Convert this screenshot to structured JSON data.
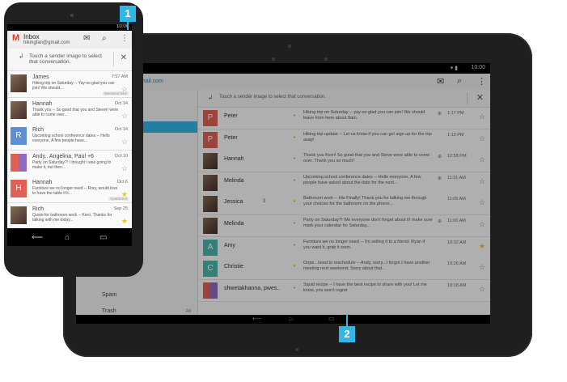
{
  "callouts": {
    "one": "1",
    "two": "2"
  },
  "colors": {
    "accent": "#33b5e5",
    "gmail_red": "#d23f31",
    "star": "#f4c20d"
  },
  "phone": {
    "status_time": "10:00",
    "title": "Inbox",
    "account": "hikingfan@gmail.com",
    "tip": "Touch a sender image to select that conversation.",
    "icons": [
      "compose-icon",
      "search-icon",
      "overflow-icon"
    ],
    "rows": [
      {
        "name": "James",
        "time": "7:57 AM",
        "snippet": "Hiking trip on Saturday -- Yay-so glad you can join! We should...",
        "avatar": "photo",
        "star": false,
        "label": "Weekend hike"
      },
      {
        "name": "Hannah",
        "time": "Oct 14",
        "snippet": "Thank you -- So good that you and Steven were able to come over...",
        "avatar": "photo",
        "star": false,
        "label": ""
      },
      {
        "name": "Rich",
        "time": "Oct 14",
        "snippet": "Upcoming school conference dates -- Hello everyone, A few people have...",
        "avatar": "R",
        "avatar_color": "#5c8fd6",
        "star": false,
        "label": ""
      },
      {
        "name": "Andy.. Angelina, Paul +6",
        "time": "Oct 10",
        "snippet": "Party on Saturday?! I thought I was going to make it, but then...",
        "avatar": "multi",
        "star": false,
        "label": ""
      },
      {
        "name": "Hannah",
        "time": "Oct 6",
        "snippet": "Furniture we no longer need -- Rory, would love to have the table if it...",
        "avatar": "H",
        "avatar_color": "#e06055",
        "star": true,
        "label": "Apartment"
      },
      {
        "name": "Rich",
        "time": "Sep 25",
        "snippet": "Quote for bathroom work -- Kerri, Thanks for talking with me today...",
        "avatar": "photo",
        "star": true,
        "label": ""
      }
    ]
  },
  "tablet": {
    "status_time": "10:00",
    "account": "gmail.com",
    "tip": "Touch a sender image to select that conversation.",
    "nav": [
      {
        "label": "Spam",
        "count": ""
      },
      {
        "label": "Trash",
        "count": "All"
      }
    ],
    "rows": [
      {
        "name": "Peter",
        "count": "",
        "snippet": "Hiking trip on Saturday -- yay-so glad you can join! We should leave from here about 8am.",
        "time": "1:17 PM",
        "avatar": "P",
        "avatar_color": "#e06055",
        "star": false,
        "attach": true
      },
      {
        "name": "Peter",
        "count": "",
        "snippet": "Hiking trip update -- Let us know if you can go! sign up for the trip asap!",
        "time": "1:13 PM",
        "avatar": "P",
        "avatar_color": "#e06055",
        "star": false,
        "attach": false
      },
      {
        "name": "Hannah",
        "count": "",
        "snippet": "Thank you Kerri! So good that you and Steve were able to come over. Thank you so much!",
        "time": "12:58 PM",
        "avatar": "photo",
        "star": false,
        "attach": true
      },
      {
        "name": "Melinda",
        "count": "",
        "snippet": "Upcoming school conference dates -- Hello everyone, A few people have asked about the date for the next...",
        "time": "11:31 AM",
        "avatar": "photo",
        "star": false,
        "attach": true
      },
      {
        "name": "Jessica",
        "count": "3",
        "snippet": "Bathroom work -- His Finally! Thank you for talking me through your choices for the bathroom on the phone...",
        "time": "11:05 AM",
        "avatar": "photo",
        "star": false,
        "attach": false
      },
      {
        "name": "Melinda",
        "count": "",
        "snippet": "Party on Saturday?! We everyone don't forget about it! make sure mark your calendar for Saturday...",
        "time": "11:00 AM",
        "avatar": "photo",
        "star": false,
        "attach": true
      },
      {
        "name": "Amy",
        "count": "",
        "snippet": "Furniture we no longer need -- I'm selling it to a friend. Ryan if you want it, grab it soon.",
        "time": "10:32 AM",
        "avatar": "A",
        "avatar_color": "#4db6ac",
        "star": true,
        "attach": false
      },
      {
        "name": "Christie",
        "count": "",
        "snippet": "Oops...need to reschedule -- Andy, sorry...I forgot I have another meeting next weekend. Sorry about that...",
        "time": "10:26 AM",
        "avatar": "C",
        "avatar_color": "#4db6ac",
        "star": false,
        "attach": false
      },
      {
        "name": "shwetakhanna, pwes..",
        "count": "",
        "snippet": "Squid recipe -- I have the best recipe to share with you! Let me know, you won't regret",
        "time": "10:18 AM",
        "avatar": "multi",
        "star": false,
        "attach": false
      }
    ]
  }
}
